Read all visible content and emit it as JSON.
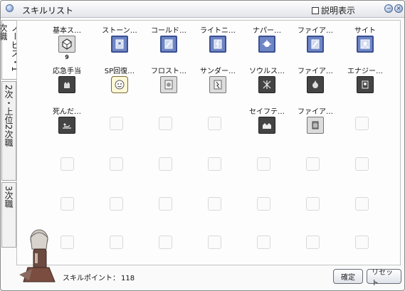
{
  "window": {
    "title": "スキルリスト",
    "description_toggle": "説明表示"
  },
  "tabs": [
    {
      "label": "ノービス・1次職"
    },
    {
      "label": "2次・上位2次職"
    },
    {
      "label": "3次職"
    }
  ],
  "skills": [
    {
      "label": "基本ス…",
      "level": "9",
      "icon": "basic-skill-icon",
      "style": "gray"
    },
    {
      "label": "ストーン…",
      "icon": "stone-skill-icon",
      "style": "blue"
    },
    {
      "label": "コールド…",
      "icon": "cold-bolt-icon",
      "style": "blue"
    },
    {
      "label": "ライトニ…",
      "icon": "lightning-bolt-icon",
      "style": "blue"
    },
    {
      "label": "ナパー…",
      "icon": "napalm-beat-icon",
      "style": "blue"
    },
    {
      "label": "ファイア…",
      "icon": "fire-bolt-icon",
      "style": "blue"
    },
    {
      "label": "サイト",
      "icon": "sight-icon",
      "style": "blue"
    },
    {
      "label": "応急手当",
      "icon": "first-aid-icon",
      "style": "dark"
    },
    {
      "label": "SP回復…",
      "icon": "sp-recovery-icon",
      "style": "yellow"
    },
    {
      "label": "フロスト…",
      "icon": "frost-diver-icon",
      "style": "gray"
    },
    {
      "label": "サンダー…",
      "icon": "thunder-storm-icon",
      "style": "gray"
    },
    {
      "label": "ソウルス…",
      "icon": "soul-strike-icon",
      "style": "dark"
    },
    {
      "label": "ファイア…",
      "icon": "fire-ball-icon",
      "style": "dark"
    },
    {
      "label": "エナジー…",
      "icon": "energy-coat-icon",
      "style": "dark"
    },
    {
      "label": "死んだ…",
      "icon": "play-dead-icon",
      "style": "dark"
    },
    {
      "label": "セイフテ…",
      "icon": "safety-wall-icon",
      "style": "dark"
    },
    {
      "label": "ファイア…",
      "icon": "fire-wall-icon",
      "style": "gray"
    }
  ],
  "footer": {
    "points_label": "スキルポイント：",
    "points_value": "118",
    "confirm_button": "確定",
    "reset_button": "リセット"
  },
  "colors": {
    "accent_blue": "#6f86c5",
    "panel_bg": "#fdfdfd",
    "border": "#c3c3c3"
  }
}
